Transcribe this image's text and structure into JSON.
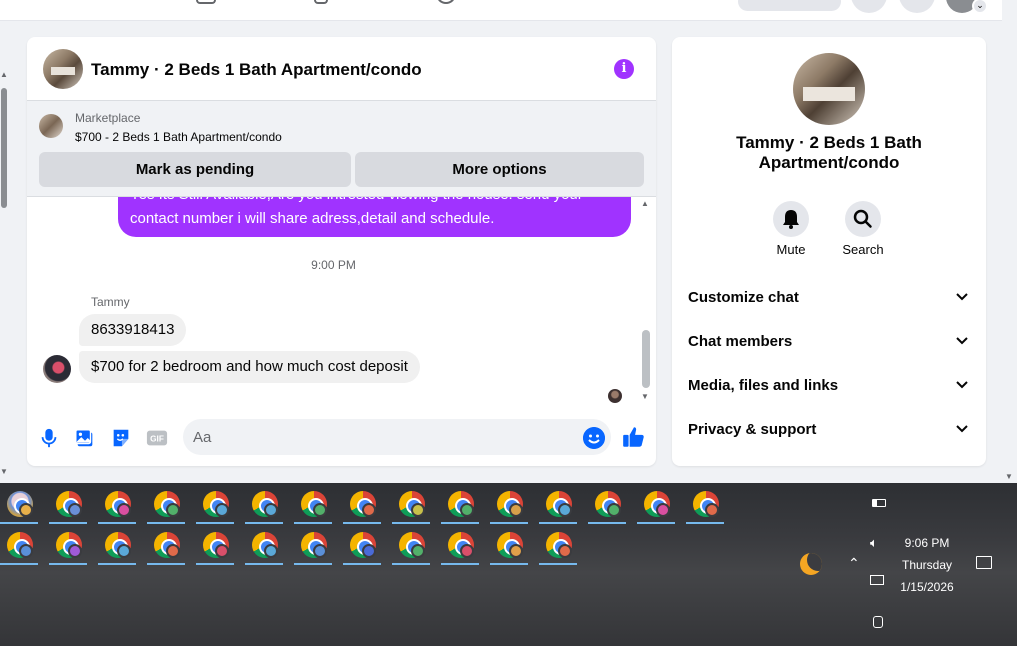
{
  "colors": {
    "accent": "#a033ff",
    "brand_blue": "#0866ff",
    "taskbar_bg": "#3a3b3f",
    "mp_button_bg": "#d8dadf"
  },
  "chat": {
    "header_title": "Tammy · 2 Beds 1 Bath Apartment/condo",
    "info_icon": "info-icon",
    "marketplace": {
      "label": "Marketplace",
      "listing": "$700 - 2 Beds 1 Bath Apartment/condo",
      "mark_pending_label": "Mark as pending",
      "more_options_label": "More options"
    },
    "messages": {
      "outgoing_line1": "Yes Its Still Available,Are you intrested viewing the house. send your",
      "outgoing_line2": "contact number i will share adress,detail and schedule.",
      "time_separator": "9:00 PM",
      "sender_name": "Tammy",
      "incoming": [
        "8633918413",
        "$700 for 2 bedroom and how much cost deposit"
      ]
    },
    "composer": {
      "placeholder": "Aa",
      "icons": [
        "microphone-icon",
        "photo-icon",
        "sticker-icon",
        "gif-icon",
        "emoji-icon",
        "thumbs-up-icon"
      ],
      "gif_label": "GIF"
    }
  },
  "info_panel": {
    "name": "Tammy · 2 Beds 1 Bath Apartment/condo",
    "actions": [
      {
        "label": "Mute",
        "icon": "bell-icon"
      },
      {
        "label": "Search",
        "icon": "search-icon"
      }
    ],
    "sections": [
      "Customize chat",
      "Chat members",
      "Media, files and links",
      "Privacy & support"
    ]
  },
  "taskbar": {
    "clock_time": "9:06 PM",
    "clock_day": "Thursday",
    "clock_date": "1/15/2026",
    "row1_profile_colors": [
      "#e8b04a",
      "#6a8fd8",
      "#d94fa0",
      "#52b06a",
      "#5aa8d8",
      "#5aa8d8",
      "#52b06a",
      "#e06a4a",
      "#c8c04a",
      "#52b06a",
      "#d8a04a",
      "#5aa8d8",
      "#52b06a",
      "#d94fa0",
      "#e06a4a"
    ],
    "row2_profile_colors": [
      "#5a8fd8",
      "#a05ad8",
      "#5aa8d8",
      "#e06a4a",
      "#d94f6a",
      "#5aa8d8",
      "#5a8fd8",
      "#4a6ad8",
      "#52b06a",
      "#d94f6a",
      "#e0a04a",
      "#e06a4a"
    ]
  }
}
